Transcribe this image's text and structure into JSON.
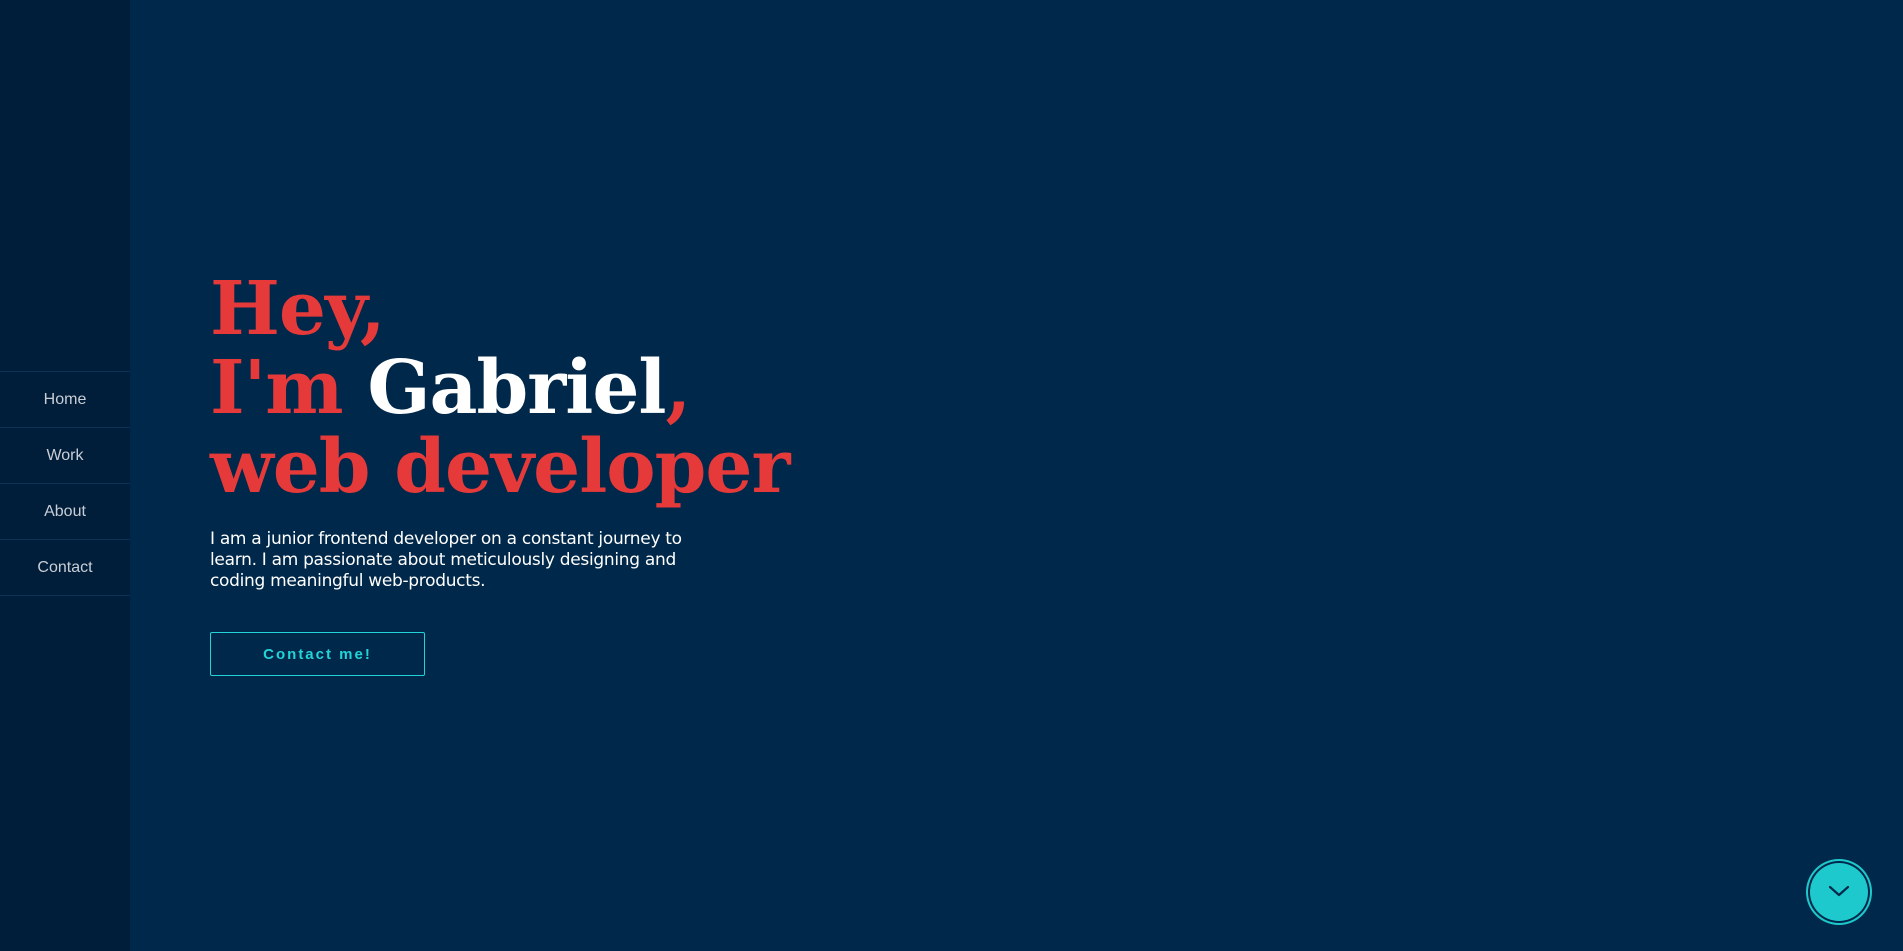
{
  "nav": {
    "items": [
      {
        "label": "Home"
      },
      {
        "label": "Work"
      },
      {
        "label": "About"
      },
      {
        "label": "Contact"
      }
    ]
  },
  "hero": {
    "line1": "Hey,",
    "line2_prefix": "I'm ",
    "name": "Gabriel",
    "line2_suffix": ",",
    "line3": "web developer",
    "intro": "I am a junior frontend developer on a constant journey to learn. I am passionate about meticulously designing and coding meaningful web-products.",
    "cta_label": "Contact me!"
  },
  "scroll_button": {
    "icon": "chevron-down-icon"
  },
  "colors": {
    "background": "#00284a",
    "sidebar": "#001e3a",
    "accent_red": "#e63a3a",
    "accent_cyan": "#22d3d7",
    "text_white": "#ffffff"
  }
}
